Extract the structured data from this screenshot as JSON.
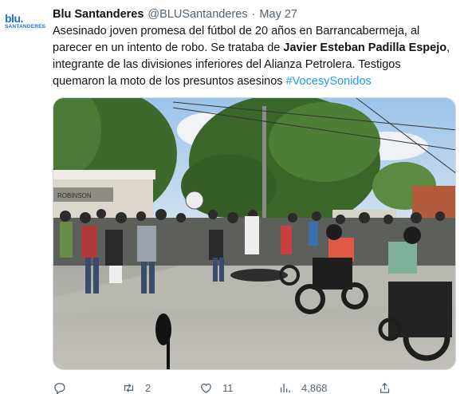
{
  "tweet": {
    "author_name": "Blu Santanderes",
    "handle": "@BLUSantanderes",
    "separator": "·",
    "date": "May 27",
    "text_part1": "Asesinado joven promesa del fútbol de 20 años en Barrancabermeja, al parecer en un intento de robo. Se trataba de ",
    "text_bold": "Javier Esteban Padilla Espejo",
    "text_part2": ", integrante de las divisiones inferiores del Alianza Petrolera. Testigos quemaron la moto de los presuntos asesinos ",
    "hashtag": "#VocesySonidos"
  },
  "avatar": {
    "logo_top": "blu",
    "logo_dot": ".",
    "logo_bottom": "SANTANDERES"
  },
  "media": {
    "sign_text": "ROBINSON"
  },
  "actions": {
    "reply_icon": "reply-icon",
    "retweet_count": "2",
    "like_count": "11",
    "views_count": "4,868"
  },
  "colors": {
    "link": "#1d9bf0",
    "brand": "#1f6fd6",
    "muted": "#536471"
  }
}
